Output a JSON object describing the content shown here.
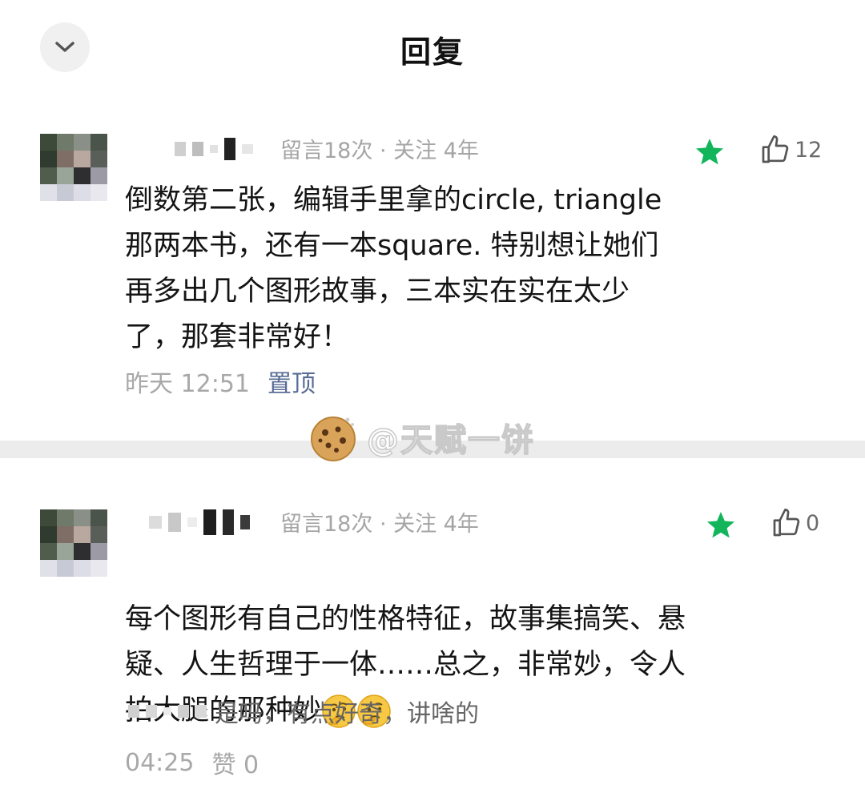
{
  "header": {
    "title": "回复",
    "back_icon": "chevron-down-icon"
  },
  "comments": [
    {
      "meta": "留言18次 · 关注 4年",
      "starred": true,
      "likes": "12",
      "text": "倒数第二张，编辑手里拿的circle, triangle\n那两本书，还有一本square. 特别想让她们\n再多出几个图形故事，三本实在实在太少\n了，那套非常好！",
      "time": "昨天 12:51",
      "pin_label": "置顶"
    },
    {
      "meta": "留言18次 · 关注 4年",
      "starred": true,
      "likes": "0",
      "text": "每个图形有自己的性格特征，故事集搞笑、悬\n疑、人生哲理于一体……总之，非常妙，令人\n拍大腿的那种妙",
      "emoji_icon": "thinking-face-icon",
      "reply_text": "是吗，有点好奇，讲啥的",
      "time": "04:25",
      "reply_like_label": "赞 0"
    }
  ],
  "watermark": {
    "text": "@天赋一饼",
    "icon": "cookie-icon"
  },
  "colors": {
    "accent_green": "#13b55b",
    "link_blue": "#576b95",
    "divider": "#ececec"
  }
}
